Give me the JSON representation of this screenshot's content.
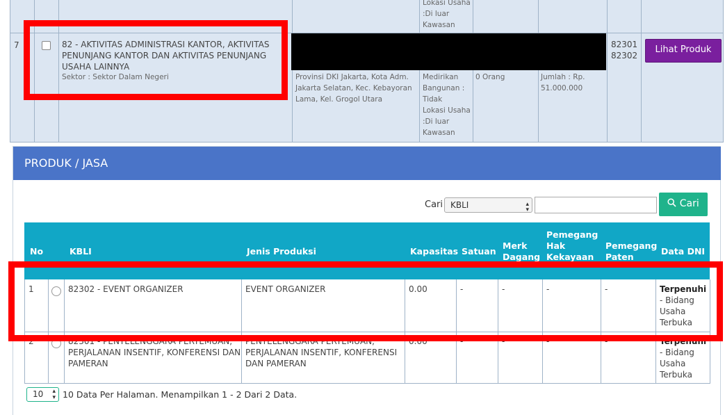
{
  "outer_table": {
    "prev_row": {
      "lokasi_lines": [
        "Lokasi Usaha",
        ":Di luar",
        "Kawasan"
      ]
    },
    "row7": {
      "no": "7",
      "kbli_title_lines": [
        "82 - AKTIVITAS ADMINISTRASI KANTOR, AKTIVITAS",
        "PENUNJANG KANTOR DAN AKTIVITAS PENUNJANG",
        "USAHA LAINNYA"
      ],
      "sektor": "Sektor : Sektor Dalam Negeri",
      "address_lines": [
        "Provinsi DKI Jakarta, Kota Adm.",
        "Jakarta Selatan, Kec. Kebayoran",
        "Lama, Kel. Grogol Utara"
      ],
      "bangunan_lines": [
        "Medirikan",
        "Bangunan :",
        "Tidak",
        "Lokasi Usaha",
        ":Di luar",
        "Kawasan"
      ],
      "orang": "0 Orang",
      "jumlah_lines": [
        "Jumlah : Rp.",
        "51.000.000"
      ],
      "codes": [
        "82301",
        "82302"
      ],
      "button_label": "Lihat Produk"
    }
  },
  "panel": {
    "title": "PRODUK / JASA",
    "search_label": "Cari",
    "search_select_value": "KBLI",
    "search_input_value": "",
    "search_button_label": "Cari"
  },
  "table": {
    "headers": {
      "no": "No",
      "kbli": "KBLI",
      "jenis": "Jenis Produksi",
      "kapasitas": "Kapasitas",
      "satuan": "Satuan",
      "merk": [
        "Merk",
        "Dagang"
      ],
      "pemegang_hak": [
        "Pemegang",
        "Hak",
        "Kekayaan"
      ],
      "pemegang_paten": [
        "Pemegang",
        "Paten"
      ],
      "data_dni": "Data DNI"
    },
    "rows": [
      {
        "no": "1",
        "kbli": "82302 - EVENT ORGANIZER",
        "jenis": "EVENT ORGANIZER",
        "kapasitas": "0.00",
        "satuan": "-",
        "merk": "-",
        "hak": "-",
        "paten": "-",
        "dni_status": "Terpenuhi",
        "dni_lines": [
          "- Bidang",
          "Usaha",
          "Terbuka"
        ]
      },
      {
        "no": "2",
        "kbli_lines": [
          "82301 - PENYELENGGARA PERTEMUAN,",
          "PERJALANAN INSENTIF, KONFERENSI DAN",
          "PAMERAN"
        ],
        "jenis_lines": [
          "PENYELENGGARA PERTEMUAN,",
          "PERJALANAN INSENTIF, KONFERENSI",
          "DAN PAMERAN"
        ],
        "kapasitas": "0.00",
        "satuan": "-",
        "merk": "-",
        "hak": "-",
        "paten": "-",
        "dni_status": "Terpenuhi",
        "dni_lines": [
          "- Bidang",
          "Usaha",
          "Terbuka"
        ]
      }
    ]
  },
  "footer": {
    "per_page_value": "10",
    "info": "10 Data Per Halaman. Menampilkan 1 - 2 Dari 2 Data."
  },
  "colors": {
    "panel_header": "#4a74c8",
    "table_header": "#11a7c6",
    "button_green": "#1fb38b",
    "button_purple": "#7a1f9e",
    "highlight": "#ff0000"
  }
}
